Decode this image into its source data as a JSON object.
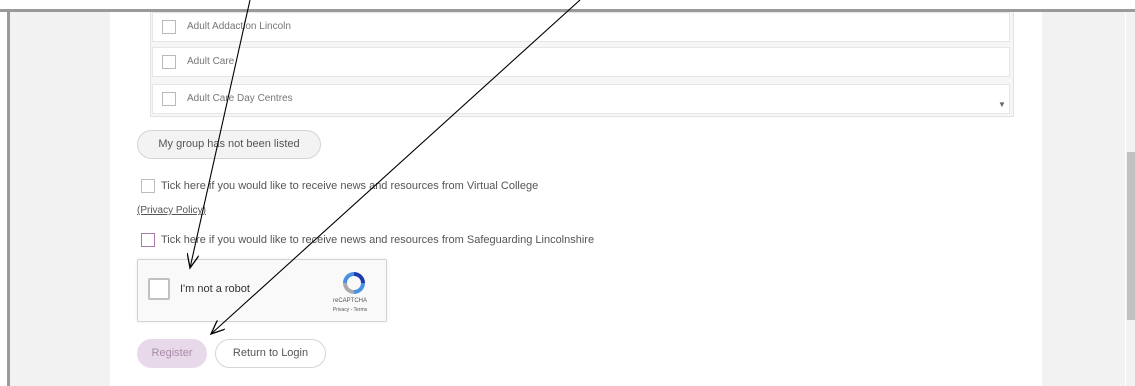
{
  "group_list": {
    "items": [
      {
        "label": "Adult Addaction Lincoln"
      },
      {
        "label": "Adult Care"
      },
      {
        "label": "Adult Care Day Centres"
      }
    ]
  },
  "group_not_listed_label": "My group has not been listed",
  "consent": {
    "virtual_college_label": "Tick here if you would like to receive news and resources from Virtual College",
    "privacy_policy_label": "(Privacy Policy)",
    "safeguarding_label": "Tick here if you would like to receive news and resources from Safeguarding Lincolnshire"
  },
  "recaptcha": {
    "label": "I'm not a robot",
    "brand": "reCAPTCHA",
    "terms": "Privacy - Terms"
  },
  "actions": {
    "register_label": "Register",
    "return_label": "Return to Login"
  },
  "colors": {
    "register_bg": "#e8d9ea",
    "register_text": "#a98aa8",
    "safeguarding_checkbox_border": "#a87aa5"
  }
}
